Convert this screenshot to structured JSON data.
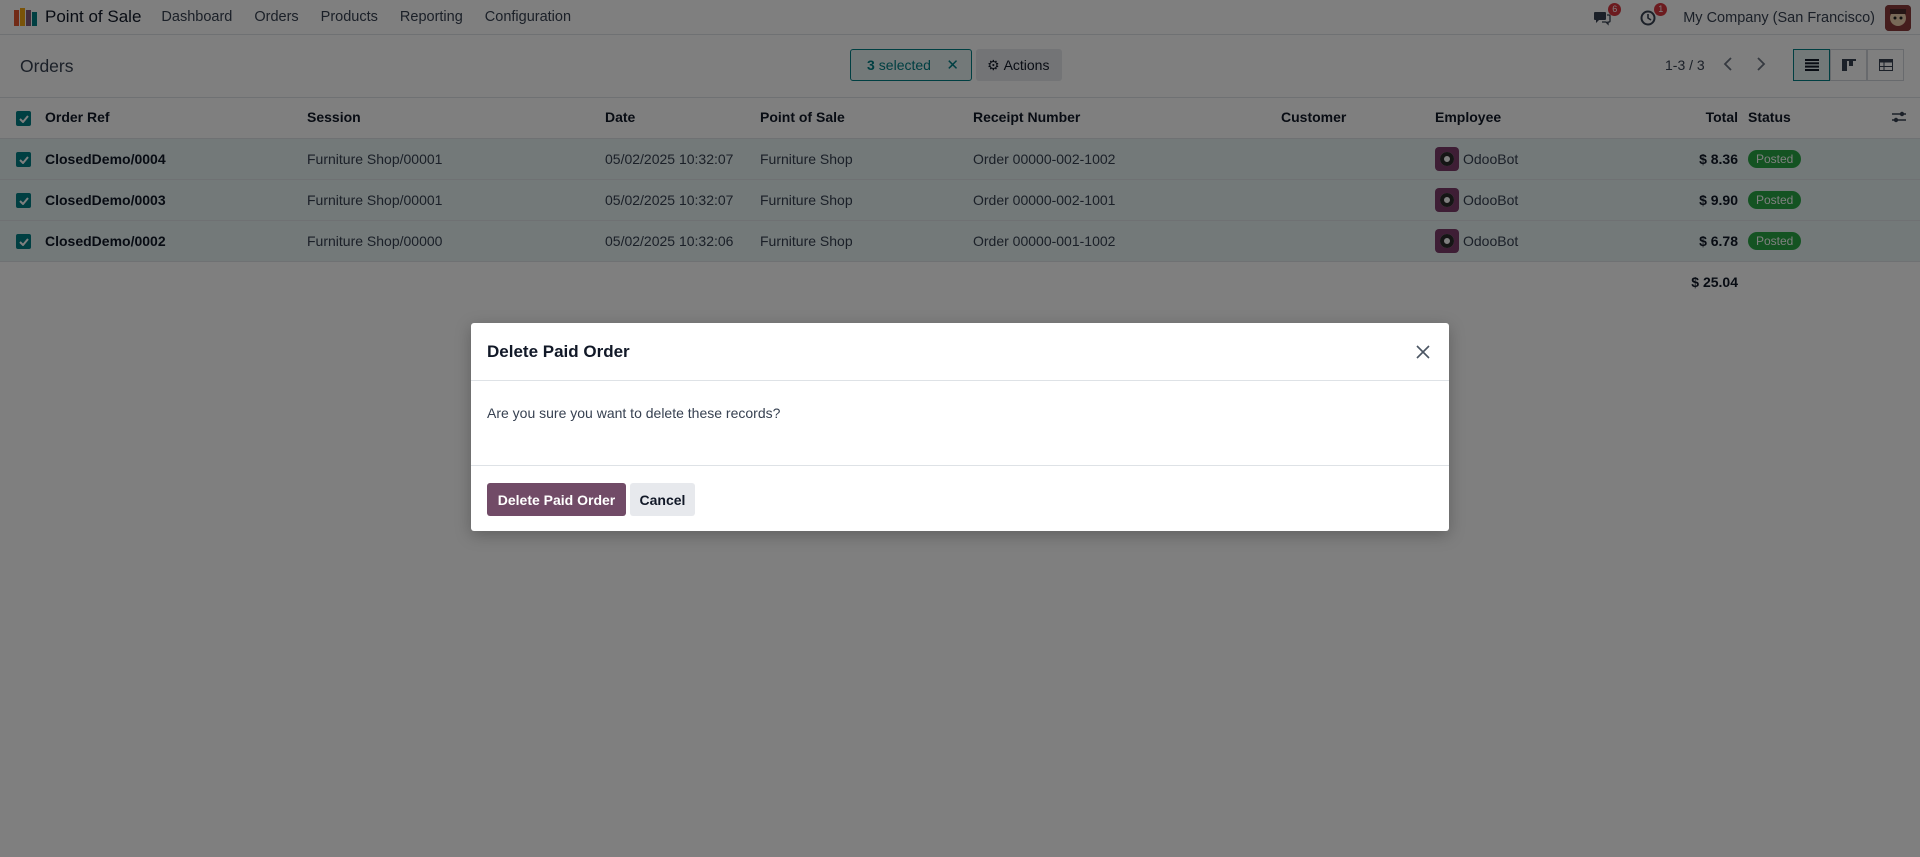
{
  "navbar": {
    "app_name": "Point of Sale",
    "menu": [
      "Dashboard",
      "Orders",
      "Products",
      "Reporting",
      "Configuration"
    ],
    "messages_badge": "6",
    "activities_badge": "1",
    "company": "My Company (San Francisco)"
  },
  "control_panel": {
    "breadcrumb": "Orders",
    "selected_count": "3",
    "selected_label": "selected",
    "actions_label": "Actions",
    "pager": "1-3 / 3"
  },
  "table": {
    "headers": {
      "ref": "Order Ref",
      "session": "Session",
      "date": "Date",
      "pos": "Point of Sale",
      "receipt": "Receipt Number",
      "customer": "Customer",
      "employee": "Employee",
      "total": "Total",
      "status": "Status"
    },
    "rows": [
      {
        "ref": "ClosedDemo/0004",
        "session": "Furniture Shop/00001",
        "date": "05/02/2025 10:32:07",
        "pos": "Furniture Shop",
        "receipt": "Order 00000-002-1002",
        "customer": "",
        "employee": "OdooBot",
        "total": "$ 8.36",
        "status": "Posted"
      },
      {
        "ref": "ClosedDemo/0003",
        "session": "Furniture Shop/00001",
        "date": "05/02/2025 10:32:07",
        "pos": "Furniture Shop",
        "receipt": "Order 00000-002-1001",
        "customer": "",
        "employee": "OdooBot",
        "total": "$ 9.90",
        "status": "Posted"
      },
      {
        "ref": "ClosedDemo/0002",
        "session": "Furniture Shop/00000",
        "date": "05/02/2025 10:32:06",
        "pos": "Furniture Shop",
        "receipt": "Order 00000-001-1002",
        "customer": "",
        "employee": "OdooBot",
        "total": "$ 6.78",
        "status": "Posted"
      }
    ],
    "grand_total": "$ 25.04"
  },
  "dialog": {
    "title": "Delete Paid Order",
    "message": "Are you sure you want to delete these records?",
    "confirm_label": "Delete Paid Order",
    "cancel_label": "Cancel"
  },
  "colors": {
    "brand": "#714b67",
    "accent": "#017e84",
    "status_posted": "#28a745"
  }
}
